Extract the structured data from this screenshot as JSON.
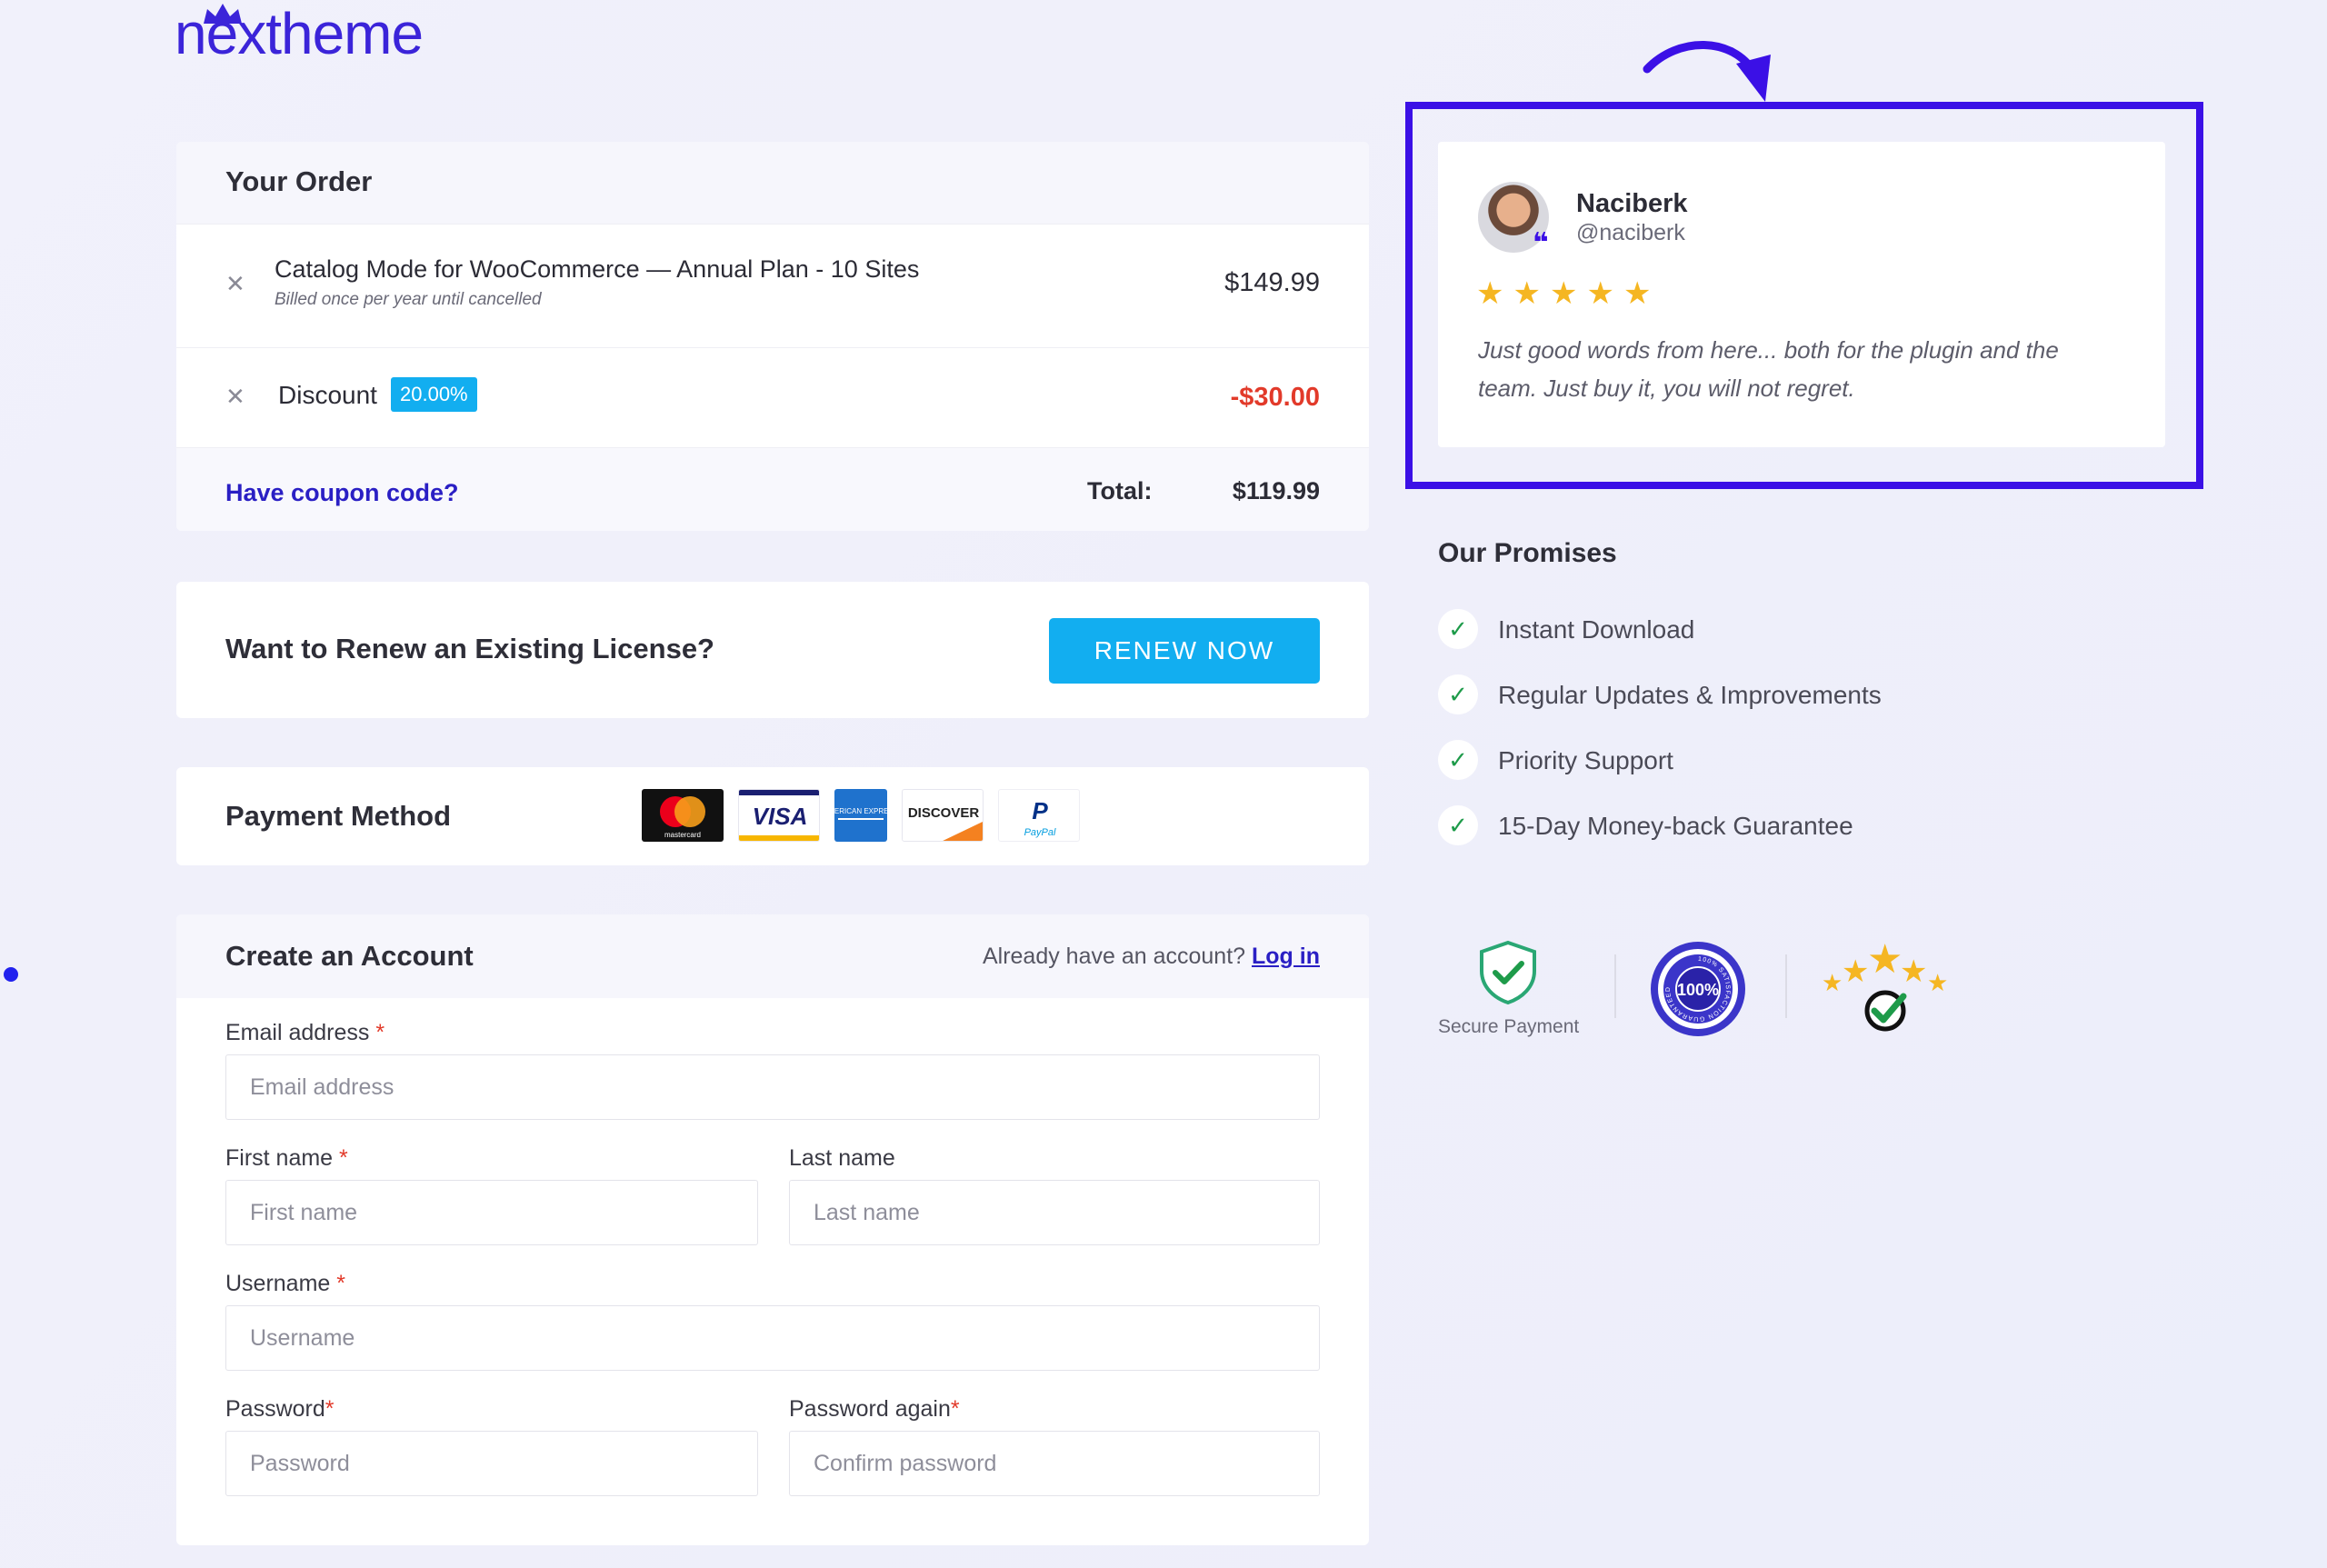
{
  "logo": {
    "text": "nextheme"
  },
  "order": {
    "title": "Your Order",
    "item": {
      "title": "Catalog Mode for WooCommerce — Annual Plan - 10 Sites",
      "subtitle": "Billed once per year until cancelled",
      "price": "$149.99"
    },
    "discount": {
      "label": "Discount",
      "badge": "20.00%",
      "amount": "-$30.00"
    },
    "coupon_link": "Have coupon code?",
    "total_label": "Total:",
    "total_value": "$119.99"
  },
  "renew": {
    "title": "Want to Renew an Existing License?",
    "button": "RENEW NOW"
  },
  "payment": {
    "title": "Payment Method",
    "methods": [
      "mastercard",
      "VISA",
      "AMERICAN EXPRESS",
      "DISCOVER",
      "PayPal"
    ]
  },
  "account": {
    "title": "Create an Account",
    "login_prompt": "Already have an account?",
    "login_link": "Log in",
    "fields": {
      "email": {
        "label": "Email address",
        "placeholder": "Email address"
      },
      "first_name": {
        "label": "First name",
        "placeholder": "First name"
      },
      "last_name": {
        "label": "Last name",
        "placeholder": "Last name"
      },
      "username": {
        "label": "Username",
        "placeholder": "Username"
      },
      "password": {
        "label": "Password",
        "placeholder": "Password"
      },
      "password_again": {
        "label": "Password again",
        "placeholder": "Confirm password"
      }
    }
  },
  "review": {
    "name": "Naciberk",
    "handle": "@naciberk",
    "rating": 5,
    "text": "Just good words from here... both for the plugin and the team. Just buy it, you will not regret."
  },
  "promises": {
    "title": "Our Promises",
    "items": [
      "Instant Download",
      "Regular Updates & Improvements",
      "Priority Support",
      "15-Day Money-back Guarantee"
    ]
  },
  "badges": {
    "secure_payment": "Secure Payment",
    "guarantee_seal": "100%",
    "guarantee_ring": "100% SATISFACTION GUARANTEED"
  },
  "colors": {
    "accent": "#3b10e6",
    "button": "#12aef0",
    "discount": "#e23a2a",
    "link": "#2a1fc4"
  }
}
